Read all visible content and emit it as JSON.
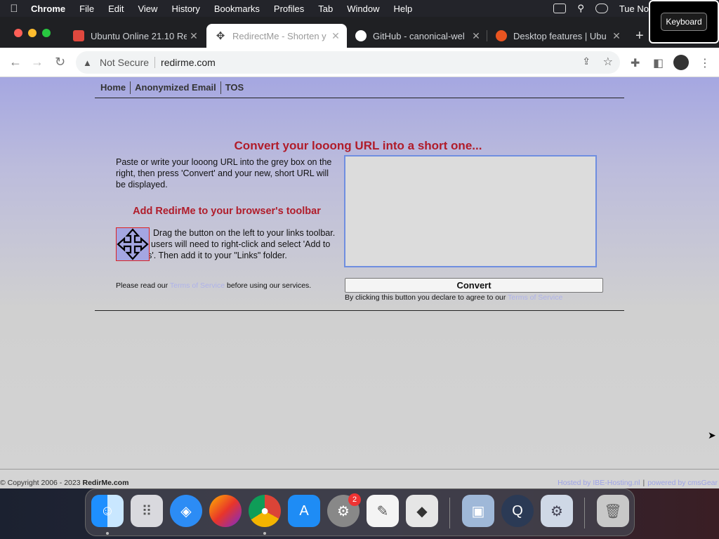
{
  "menubar": {
    "app_name": "Chrome",
    "items": [
      "File",
      "Edit",
      "View",
      "History",
      "Bookmarks",
      "Profiles",
      "Tab",
      "Window",
      "Help"
    ],
    "clock": "Tue No"
  },
  "keyboard_popup": {
    "label": "Keyboard"
  },
  "tabs": [
    {
      "title": "Ubuntu Online 21.10 Re",
      "favicon": "ubuntu-red-square-icon",
      "color": "#e0483e"
    },
    {
      "title": "RedirectMe - Shorten y",
      "favicon": "move-arrows-icon",
      "color": "#4a4a8a"
    },
    {
      "title": "GitHub - canonical-wel",
      "favicon": "github-icon",
      "color": "#ffffff"
    },
    {
      "title": "Desktop features | Ubu",
      "favicon": "ubuntu-logo-icon",
      "color": "#e95420"
    }
  ],
  "toolbar": {
    "security_label": "Not Secure",
    "url": "redirme.com"
  },
  "page": {
    "nav": [
      "Home",
      "Anonymized Email",
      "TOS"
    ],
    "headline": "Convert your looong URL into a short one...",
    "intro": "Paste or write your looong URL into the grey box on the right, then press 'Convert' and your new, short URL will be displayed.",
    "toolbar_heading": "Add RedirMe to your browser's toolbar",
    "drag_text": "Drag the button on the left to your links toolbar. Explorer users will need to right-click and select 'Add to Favorites'. Then add it to your \"Links\" folder.",
    "read_prefix": "Please read our",
    "terms_link": "Terms of Service",
    "read_suffix": "before using our services.",
    "url_input_value": "",
    "convert_label": "Convert",
    "agree_prefix": "By clicking this button you declare to agree to our",
    "agree_link": "Terms of Service"
  },
  "footer": {
    "copyright": "© Copyright 2006 - 2023",
    "site": "RedirMe.com",
    "hosted": "Hosted by IBE-Hosting.nl",
    "powered": "powered by cmsGear"
  },
  "dock": {
    "apps": [
      "Finder",
      "Launchpad",
      "Safari",
      "Firefox",
      "Chrome",
      "App Store",
      "System Preferences",
      "TextEdit",
      "Roblox",
      "Preview",
      "QuickTime",
      "Utility",
      "Trash"
    ],
    "badge_count": "2"
  },
  "colors": {
    "accent": "#b01c2a",
    "page_bg": "#a5a7e1",
    "link": "#aeb2ea"
  }
}
